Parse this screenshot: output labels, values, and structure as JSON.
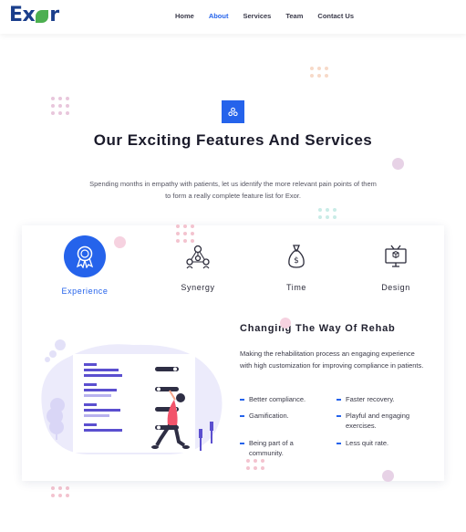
{
  "header": {
    "logo": {
      "text_before": "Ex",
      "text_after": "r"
    },
    "nav": [
      {
        "label": "Home",
        "active": false
      },
      {
        "label": "About",
        "active": true
      },
      {
        "label": "Services",
        "active": false
      },
      {
        "label": "Team",
        "active": false
      },
      {
        "label": "Contact Us",
        "active": false
      }
    ]
  },
  "section": {
    "badge_icon": "cluster-icon",
    "title": "Our Exciting Features And Services",
    "subtitle": "Spending months in empathy with patients, let us identify the more relevant pain points of them to form a really complete feature list for Exor."
  },
  "tabs": [
    {
      "label": "Experience",
      "icon": "award-ribbon-icon",
      "active": true
    },
    {
      "label": "Synergy",
      "icon": "network-icon",
      "active": false
    },
    {
      "label": "Time",
      "icon": "money-bag-icon",
      "active": false
    },
    {
      "label": "Design",
      "icon": "monitor-icon",
      "active": false
    }
  ],
  "content": {
    "title": "Changing The Way Of Rehab",
    "description": "Making the rehabilitation process an engaging experience with high customization for improving compliance in patients.",
    "features": [
      "Better compliance.",
      "Faster recovery.",
      "Gamification.",
      "Playful and engaging exercises.",
      "Being part of a community.",
      "Less quit rate."
    ]
  },
  "colors": {
    "accent": "#2563eb",
    "logo": "#1b3f8c",
    "leaf": "#4caf50",
    "illustration_purple": "#5b4fcf",
    "illustration_pink": "#f2546b"
  }
}
